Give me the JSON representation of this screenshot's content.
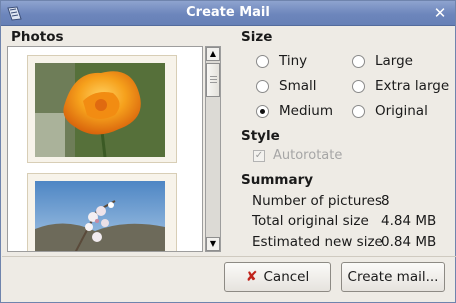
{
  "window": {
    "title": "Create Mail",
    "icons": {
      "app": "mail-app-icon",
      "close": "close-icon"
    }
  },
  "photos": {
    "heading": "Photos",
    "items": [
      {
        "name": "orange-poppy-photo",
        "colors": [
          "#f0a020",
          "#d86a10",
          "#5f7a3a"
        ]
      },
      {
        "name": "flowering-branch-photo",
        "colors": [
          "#6f9ed1",
          "#efeef0",
          "#7b6a5a"
        ]
      }
    ]
  },
  "size": {
    "heading": "Size",
    "options": [
      {
        "label": "Tiny",
        "selected": false
      },
      {
        "label": "Large",
        "selected": false
      },
      {
        "label": "Small",
        "selected": false
      },
      {
        "label": "Extra large",
        "selected": false
      },
      {
        "label": "Medium",
        "selected": true
      },
      {
        "label": "Original",
        "selected": false
      }
    ]
  },
  "style": {
    "heading": "Style",
    "autorotate": {
      "label": "Autorotate",
      "checked": true,
      "enabled": false
    }
  },
  "summary": {
    "heading": "Summary",
    "rows": [
      {
        "label": "Number of pictures",
        "value": "8"
      },
      {
        "label": "Total original size",
        "value": "4.84 MB"
      },
      {
        "label": "Estimated new size",
        "value": "0.84 MB"
      }
    ]
  },
  "buttons": {
    "cancel": "Cancel",
    "create": "Create mail..."
  }
}
